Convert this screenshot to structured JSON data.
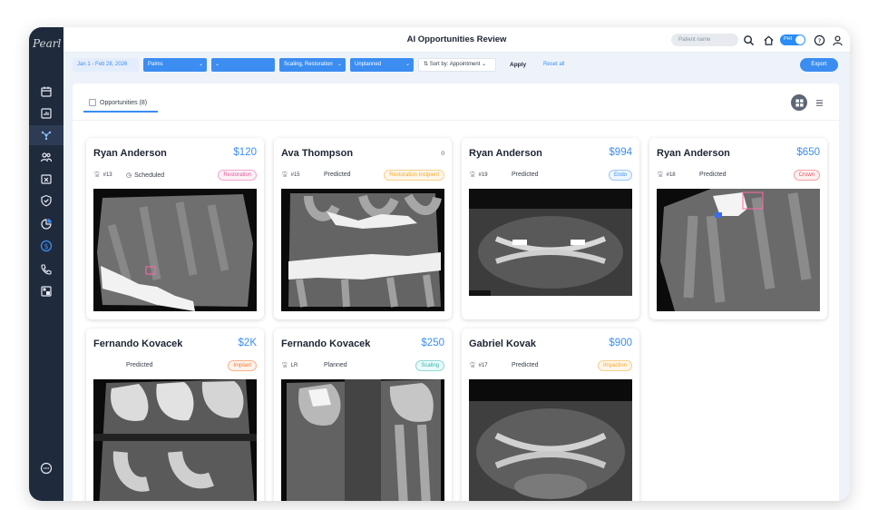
{
  "app": {
    "title": "AI Opportunities Review",
    "logo_text": "Pearl"
  },
  "topbar": {
    "patient_placeholder": "Patient name",
    "toggle_label": "PHI"
  },
  "filters": {
    "date": "Jan 1 - Feb 28, 2026",
    "location": "Palms",
    "provider": "",
    "procedures": "Scaling, Restoration",
    "status": "Unplanned",
    "sort": "Sort by: Appointment",
    "apply": "Apply",
    "reset": "Reset all",
    "export": "Export"
  },
  "tabs": [
    {
      "label": "Opportunities (8)"
    }
  ],
  "colors": {
    "accent": "#3b8df1",
    "sidebar": "#1f2a3d"
  },
  "cards": [
    {
      "name": "Ryan Anderson",
      "price": "$120",
      "tooth": "#13",
      "status": "Scheduled",
      "tag": "Restoration",
      "tag_color": "#e0569b"
    },
    {
      "name": "Ava Thompson",
      "price": "0",
      "tooth": "#15",
      "status": "Predicted",
      "tag": "Restoration Incipient",
      "tag_color": "#f0a830"
    },
    {
      "name": "Ryan Anderson",
      "price": "$994",
      "tooth": "#19",
      "status": "Predicted",
      "tag": "Endo",
      "tag_color": "#3b8df1"
    },
    {
      "name": "Ryan Anderson",
      "price": "$650",
      "tooth": "#18",
      "status": "Predicted",
      "tag": "Crown",
      "tag_color": "#e05560"
    },
    {
      "name": "Fernando Kovacek",
      "price": "$2K",
      "tooth": "",
      "status": "Predicted",
      "tag": "Implant",
      "tag_color": "#f07a30"
    },
    {
      "name": "Fernando Kovacek",
      "price": "$250",
      "tooth": "LR",
      "status": "Planned",
      "tag": "Scaling",
      "tag_color": "#2bb3b0"
    },
    {
      "name": "Gabriel Kovak",
      "price": "$900",
      "tooth": "#17",
      "status": "Predicted",
      "tag": "Impaction",
      "tag_color": "#f0a830"
    }
  ]
}
